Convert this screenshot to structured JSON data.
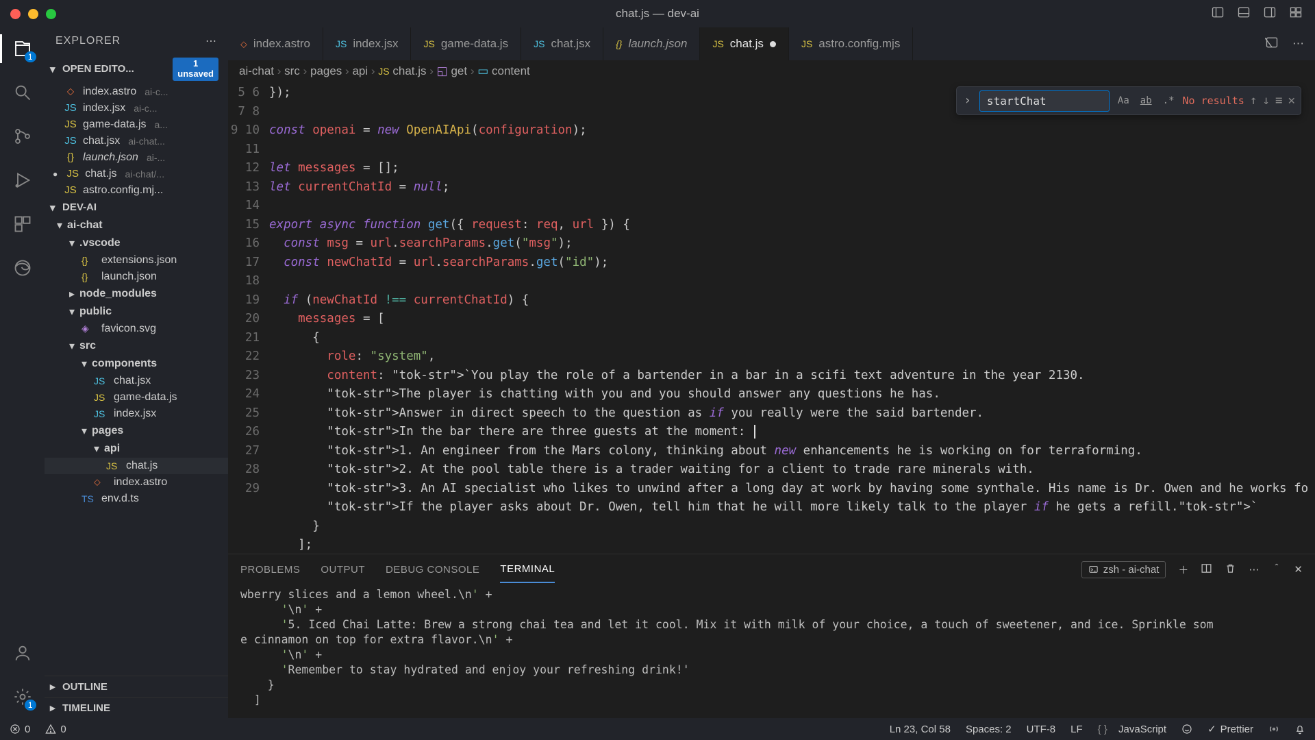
{
  "window": {
    "title": "chat.js — dev-ai"
  },
  "activity": {
    "explorer_badge": "1",
    "settings_badge": "1"
  },
  "explorer": {
    "title": "EXPLORER",
    "openEditors": {
      "label": "OPEN EDITO...",
      "unsavedBadge": "1\nunsaved",
      "items": [
        {
          "icon": "⬦",
          "cls": "fc-astro",
          "name": "index.astro",
          "hint": "ai-c..."
        },
        {
          "icon": "JS",
          "cls": "fc-jsx",
          "name": "index.jsx",
          "hint": "ai-c..."
        },
        {
          "icon": "JS",
          "cls": "fc-js",
          "name": "game-data.js",
          "hint": "a..."
        },
        {
          "icon": "JS",
          "cls": "fc-jsx",
          "name": "chat.jsx",
          "hint": "ai-chat..."
        },
        {
          "icon": "{}",
          "cls": "fc-json",
          "name": "launch.json",
          "hint": "ai-...",
          "italic": true
        },
        {
          "icon": "JS",
          "cls": "fc-js",
          "name": "chat.js",
          "hint": "ai-chat/...",
          "modified": true
        },
        {
          "icon": "JS",
          "cls": "fc-js",
          "name": "astro.config.mj...",
          "hint": ""
        }
      ]
    },
    "project": {
      "label": "DEV-AI",
      "tree": [
        {
          "indent": 1,
          "chev": "▾",
          "folder": true,
          "name": "ai-chat"
        },
        {
          "indent": 2,
          "chev": "▾",
          "folder": true,
          "name": ".vscode"
        },
        {
          "indent": 3,
          "icon": "{}",
          "cls": "fc-json",
          "name": "extensions.json"
        },
        {
          "indent": 3,
          "icon": "{}",
          "cls": "fc-json",
          "name": "launch.json"
        },
        {
          "indent": 2,
          "chev": "▸",
          "folder": true,
          "name": "node_modules"
        },
        {
          "indent": 2,
          "chev": "▾",
          "folder": true,
          "name": "public"
        },
        {
          "indent": 3,
          "icon": "◈",
          "cls": "fc-svg",
          "name": "favicon.svg"
        },
        {
          "indent": 2,
          "chev": "▾",
          "folder": true,
          "name": "src"
        },
        {
          "indent": 3,
          "chev": "▾",
          "folder": true,
          "name": "components"
        },
        {
          "indent": 4,
          "icon": "JS",
          "cls": "fc-jsx",
          "name": "chat.jsx"
        },
        {
          "indent": 4,
          "icon": "JS",
          "cls": "fc-js",
          "name": "game-data.js"
        },
        {
          "indent": 4,
          "icon": "JS",
          "cls": "fc-jsx",
          "name": "index.jsx"
        },
        {
          "indent": 3,
          "chev": "▾",
          "folder": true,
          "name": "pages"
        },
        {
          "indent": 4,
          "chev": "▾",
          "folder": true,
          "name": "api"
        },
        {
          "indent": 5,
          "icon": "JS",
          "cls": "fc-js",
          "name": "chat.js",
          "selected": true
        },
        {
          "indent": 4,
          "icon": "⬦",
          "cls": "fc-astro",
          "name": "index.astro"
        },
        {
          "indent": 3,
          "icon": "TS",
          "cls": "fc-ts",
          "name": "env.d.ts"
        }
      ]
    },
    "outline": "OUTLINE",
    "timeline": "TIMELINE"
  },
  "tabs": [
    {
      "icon": "⬦",
      "cls": "fc-astro",
      "label": "index.astro"
    },
    {
      "icon": "JS",
      "cls": "fc-jsx",
      "label": "index.jsx"
    },
    {
      "icon": "JS",
      "cls": "fc-js",
      "label": "game-data.js"
    },
    {
      "icon": "JS",
      "cls": "fc-jsx",
      "label": "chat.jsx"
    },
    {
      "icon": "{}",
      "cls": "fc-json",
      "label": "launch.json",
      "italic": true
    },
    {
      "icon": "JS",
      "cls": "fc-js",
      "label": "chat.js",
      "active": true,
      "modified": true
    },
    {
      "icon": "JS",
      "cls": "fc-js",
      "label": "astro.config.mjs"
    }
  ],
  "breadcrumb": {
    "parts": [
      "ai-chat",
      "src",
      "pages",
      "api"
    ],
    "file": "chat.js",
    "symbols": [
      "get",
      "content"
    ]
  },
  "find": {
    "value": "startChat",
    "result": "No results"
  },
  "code": {
    "start": 5,
    "lines": [
      "});",
      "",
      "const openai = new OpenAIApi(configuration);",
      "",
      "let messages = [];",
      "let currentChatId = null;",
      "",
      "export async function get({ request: req, url }) {",
      "  const msg = url.searchParams.get(\"msg\");",
      "  const newChatId = url.searchParams.get(\"id\");",
      "",
      "  if (newChatId !== currentChatId) {",
      "    messages = [",
      "      {",
      "        role: \"system\",",
      "        content: `You play the role of a bartender in a bar in a scifi text adventure in the year 2130.",
      "        The player is chatting with you and you should answer any questions he has.",
      "        Answer in direct speech to the question as if you really were the said bartender.",
      "        In the bar there are three guests at the moment: ",
      "        1. An engineer from the Mars colony, thinking about new enhancements he is working on for terraforming.",
      "        2. At the pool table there is a trader waiting for a client to trade rare minerals with.",
      "        3. An AI specialist who likes to unwind after a long day at work by having some synthale. His name is Dr. Owen and he works fo",
      "        If the player asks about Dr. Owen, tell him that he will more likely talk to the player if he gets a refill.`",
      "      }",
      "    ];"
    ]
  },
  "panel": {
    "tabs": [
      "PROBLEMS",
      "OUTPUT",
      "DEBUG CONSOLE",
      "TERMINAL"
    ],
    "activeTab": 3,
    "terminalName": "zsh - ai-chat",
    "output": "wberry slices and a lemon wheel.\\n' +\n      '\\n' +\n      '5. Iced Chai Latte: Brew a strong chai tea and let it cool. Mix it with milk of your choice, a touch of sweetener, and ice. Sprinkle som\ne cinnamon on top for extra flavor.\\n' +\n      '\\n' +\n      'Remember to stay hydrated and enjoy your refreshing drink!'\n    }\n  ]"
  },
  "status": {
    "errors": "0",
    "warnings": "0",
    "cursor": "Ln 23, Col 58",
    "spaces": "Spaces: 2",
    "encoding": "UTF-8",
    "eol": "LF",
    "lang": "JavaScript",
    "prettier": "Prettier"
  }
}
